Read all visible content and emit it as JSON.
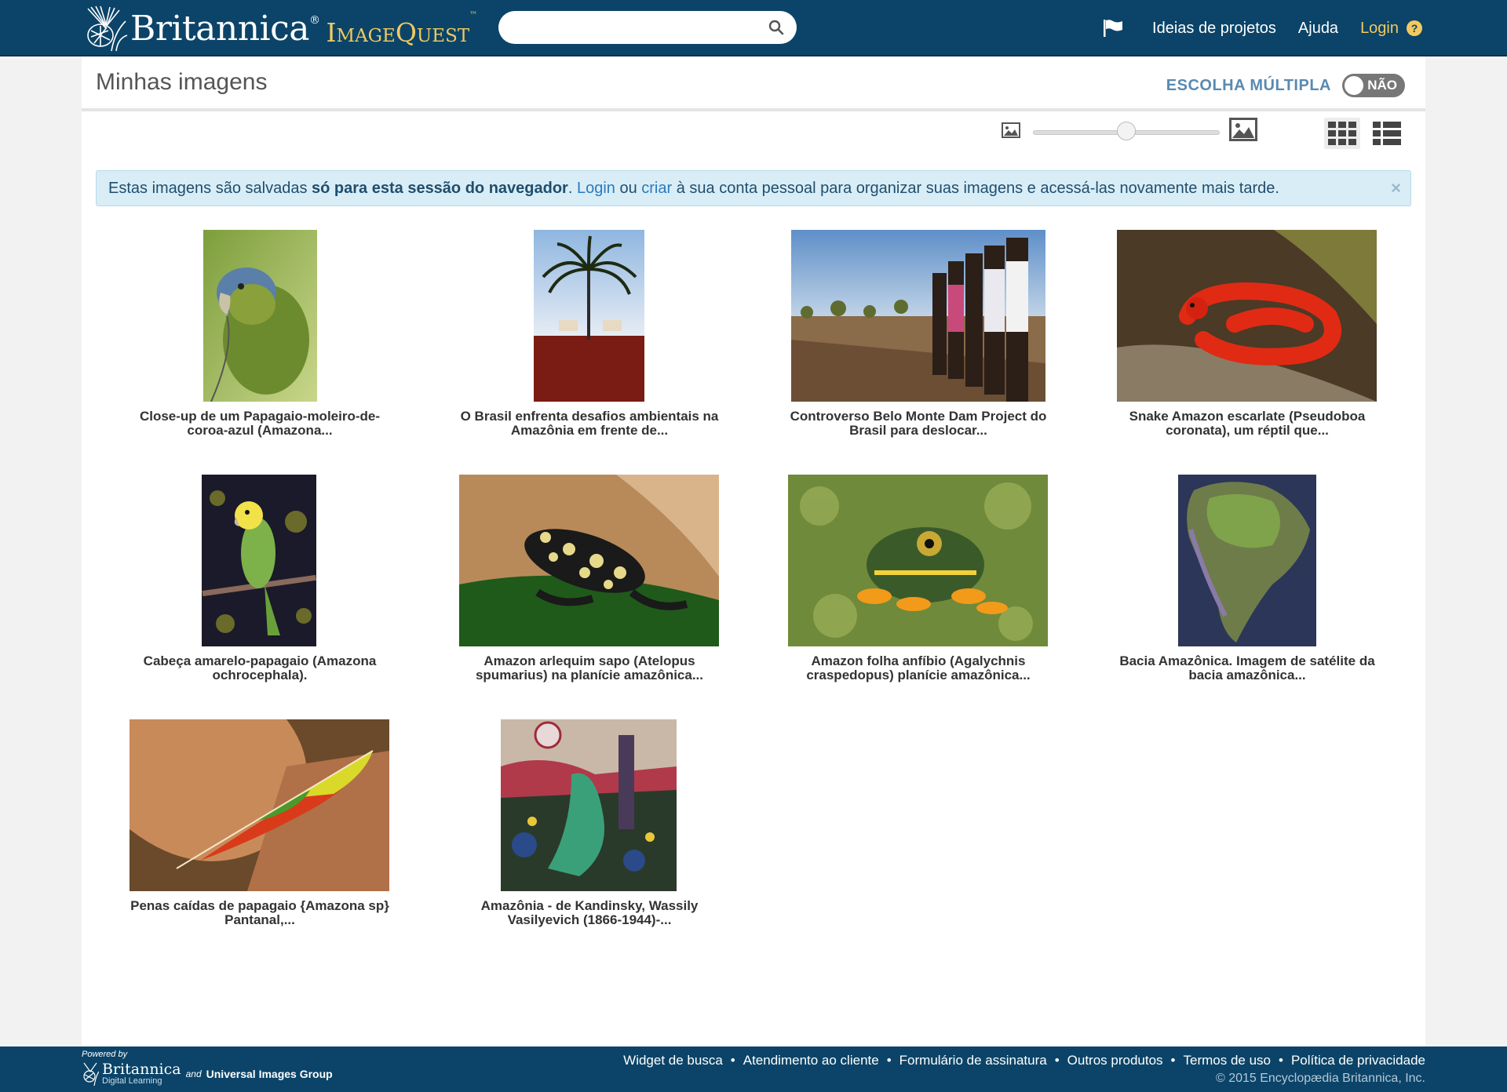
{
  "header": {
    "brand": "Britannica",
    "brand_reg": "®",
    "product": "ImageQuest",
    "product_tm": "™",
    "search_placeholder": "",
    "nav": {
      "projects": "Ideias de projetos",
      "help": "Ajuda",
      "login": "Login",
      "help_badge": "?"
    }
  },
  "page": {
    "title": "Minhas imagens",
    "multi_select_label": "ESCOLHA MÚLTIPLA",
    "multi_select_state": "NÃO",
    "thumbnail_size_level": 0.5
  },
  "notice": {
    "t1": "Estas imagens são salvadas ",
    "bold": "só para esta sessão do navegador",
    "t2": ". ",
    "login": "Login",
    "t3": " ou ",
    "create": "criar",
    "t4": " à sua conta pessoal para organizar suas imagens e acessá-las novamente mais tarde.",
    "close": "×"
  },
  "images": [
    {
      "line1": "Close-up de um Papagaio-moleiro-de-",
      "line2": "coroa-azul (Amazona...",
      "icon": "parrot"
    },
    {
      "line1": "O Brasil enfrenta desafios ambientais na",
      "line2": "Amazônia em frente de...",
      "icon": "palm-cattle"
    },
    {
      "line1": "Controverso Belo Monte Dam Project do",
      "line2": "Brasil para deslocar...",
      "icon": "crowd"
    },
    {
      "line1": "Snake Amazon escarlate (Pseudoboa",
      "line2": "coronata), um réptil que...",
      "icon": "snake"
    },
    {
      "line1": "Cabeça amarelo-papagaio (Amazona",
      "line2": "ochrocephala).",
      "icon": "yellow-parrot"
    },
    {
      "line1": "Amazon arlequim sapo (Atelopus",
      "line2": "spumarius) na planície amazônica...",
      "icon": "harlequin-frog"
    },
    {
      "line1": "Amazon folha anfíbio (Agalychnis",
      "line2": "craspedopus) planície amazônica...",
      "icon": "leaf-frog"
    },
    {
      "line1": "Bacia Amazônica. Imagem de satélite da",
      "line2": "bacia amazônica...",
      "icon": "satellite-map"
    },
    {
      "line1": "Penas caídas de papagaio {Amazona sp}",
      "line2": "Pantanal,...",
      "icon": "feather"
    },
    {
      "line1": "Amazônia - de Kandinsky, Wassily",
      "line2": "Vasilyevich (1866-1944)-...",
      "icon": "painting"
    }
  ],
  "footer": {
    "powered_by": "Powered by",
    "brand": "Britannica",
    "brand_sub": "Digital Learning",
    "and": "and",
    "partner": "Universal Images Group",
    "links": [
      "Widget de busca",
      "Atendimento ao cliente",
      "Formulário de assinatura",
      "Outros produtos",
      "Termos de uso",
      "Política de privacidade"
    ],
    "separator": "•",
    "copyright": "© 2015 Encyclopædia Britannica, Inc."
  }
}
